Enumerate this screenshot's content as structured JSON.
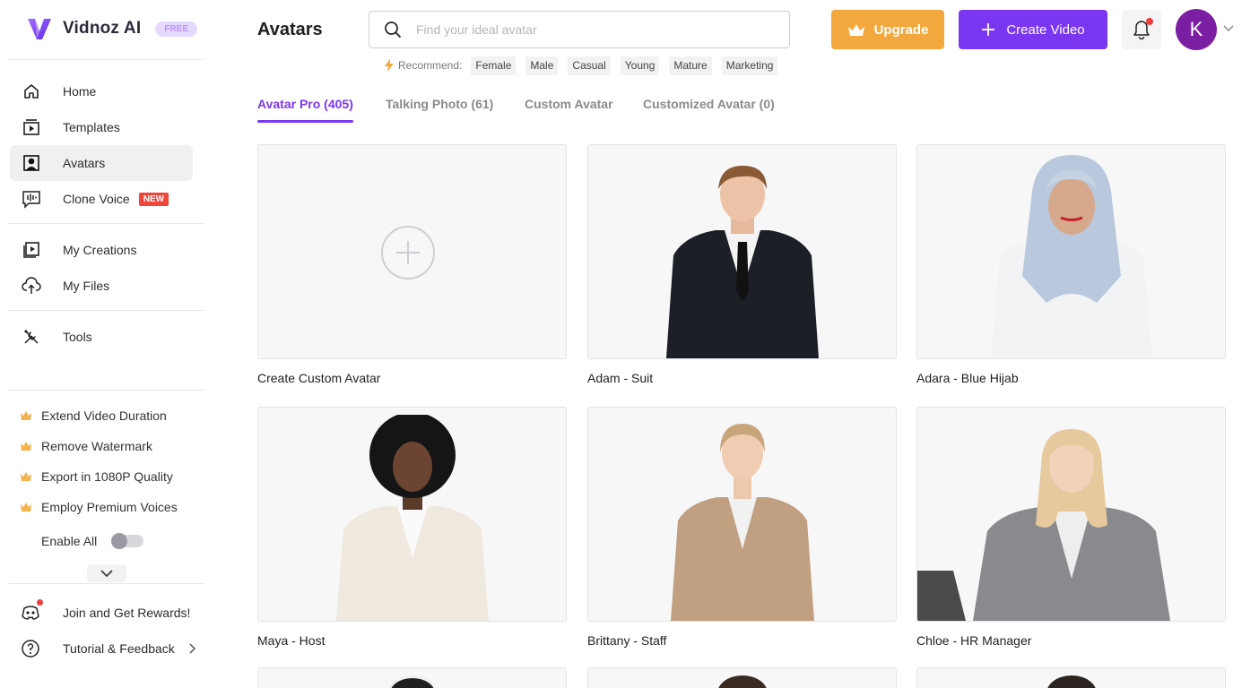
{
  "app": {
    "logo_text": "Vidnoz AI",
    "plan_badge": "FREE",
    "accent_color": "#7b36f2",
    "upgrade_color": "#f2a83c"
  },
  "sidebar": {
    "nav": [
      {
        "label": "Home",
        "icon": "home-icon"
      },
      {
        "label": "Templates",
        "icon": "templates-icon"
      },
      {
        "label": "Avatars",
        "icon": "avatar-icon",
        "active": true
      },
      {
        "label": "Clone Voice",
        "icon": "voice-wave-icon",
        "badge": "NEW"
      },
      {
        "label": "My Creations",
        "icon": "video-library-icon"
      },
      {
        "label": "My Files",
        "icon": "cloud-upload-icon"
      },
      {
        "label": "Tools",
        "icon": "tools-icon"
      }
    ],
    "perks": [
      "Extend Video Duration",
      "Remove Watermark",
      "Export in 1080P Quality",
      "Employ Premium Voices"
    ],
    "enable_all_label": "Enable All",
    "enable_all_on": false,
    "bottom": [
      {
        "label": "Join and Get Rewards!",
        "icon": "discord-icon"
      },
      {
        "label": "Tutorial & Feedback",
        "icon": "help-icon"
      }
    ]
  },
  "header": {
    "title": "Avatars",
    "search_placeholder": "Find your ideal avatar",
    "recommend_label": "Recommend:",
    "tags": [
      "Female",
      "Male",
      "Casual",
      "Young",
      "Mature",
      "Marketing"
    ],
    "upgrade_label": "Upgrade",
    "create_label": "Create Video",
    "user_initial": "K"
  },
  "tabs": [
    {
      "label": "Avatar Pro (405)",
      "active": true
    },
    {
      "label": "Talking Photo (61)"
    },
    {
      "label": "Custom Avatar"
    },
    {
      "label": "Customized Avatar (0)"
    }
  ],
  "cards": [
    {
      "name": "Create Custom Avatar"
    },
    {
      "name": "Adam - Suit"
    },
    {
      "name": "Adara - Blue Hijab"
    },
    {
      "name": "Maya - Host"
    },
    {
      "name": "Brittany - Staff"
    },
    {
      "name": "Chloe - HR Manager"
    }
  ]
}
